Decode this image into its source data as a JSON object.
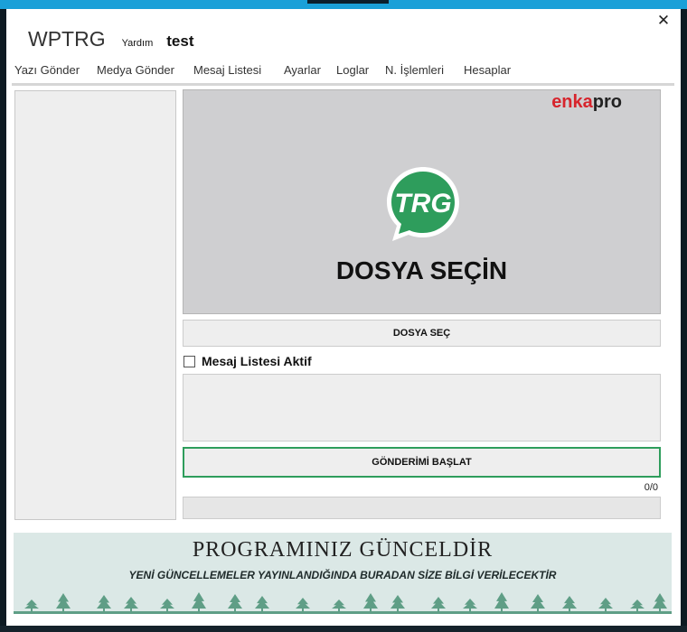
{
  "window": {
    "title": "WPTRG",
    "help_label": "Yardım",
    "user_name": "test",
    "close_glyph": "✕"
  },
  "tabs": [
    {
      "label": "Yazı Gönder",
      "active": false
    },
    {
      "label": "Medya Gönder",
      "active": true
    },
    {
      "label": "Mesaj Listesi",
      "active": false
    },
    {
      "label": "Ayarlar",
      "active": false
    },
    {
      "label": "Loglar",
      "active": false
    },
    {
      "label": "N. İşlemleri",
      "active": false
    },
    {
      "label": "Hesaplar",
      "active": false
    }
  ],
  "preview": {
    "brand_part1": "enka",
    "brand_part2": "pro",
    "logo_text": "TRG",
    "caption": "DOSYA SEÇİN"
  },
  "buttons": {
    "select_file": "DOSYA SEÇ",
    "start_sending": "GÖNDERİMİ BAŞLAT"
  },
  "message_list_toggle": {
    "label": "Mesaj Listesi Aktif",
    "checked": false
  },
  "message_input": {
    "value": ""
  },
  "progress": {
    "counter": "0/0",
    "fraction": 0
  },
  "banner": {
    "title": "PROGRAMINIZ GÜNCELDİR",
    "subtitle": "YENİ GÜNCELLEMELER YAYINLANDIĞINDA BURADAN SİZE BİLGİ VERİLECEKTİR"
  },
  "colors": {
    "accent": "#1aa0d8",
    "green": "#2e9d5c",
    "brand_red": "#d7242c",
    "tree": "#5f9e86"
  },
  "icons": {
    "close": "close-icon",
    "logo": "trg-chat-logo-icon",
    "checkbox": "checkbox-icon"
  }
}
